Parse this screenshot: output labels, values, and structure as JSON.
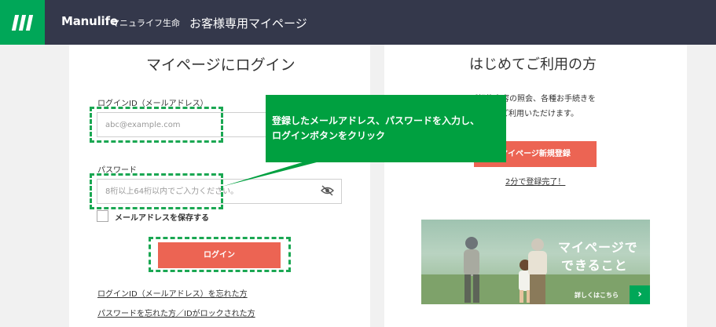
{
  "header": {
    "brand": "Manulife",
    "brand_sub": "マニュライフ生命",
    "title": "お客様専用マイページ"
  },
  "login": {
    "title": "マイページにログイン",
    "id_label": "ログインID（メールアドレス）",
    "id_placeholder": "abc@example.com",
    "password_label": "パスワード",
    "password_placeholder": "8桁以上64桁以内でご入力ください。",
    "save_label": "メールアドレスを保存する",
    "login_button": "ログイン",
    "forgot_id": "ログインID（メールアドレス）を忘れた方",
    "forgot_password": "パスワードを忘れた方／IDがロックされた方"
  },
  "first_time": {
    "title": "はじめてご利用の方",
    "desc_line1": "ご契約内容の照会、各種お手続きを",
    "desc_line2": "ご利用いただけます。",
    "register_button": "マイページ新規登録",
    "register_note": "2分で登録完了！"
  },
  "banner": {
    "title_line1": "マイページで",
    "title_line2": "できること",
    "link": "詳しくはこちら",
    "arrow": "›"
  },
  "callout": {
    "line1": "登録したメールアドレス、パスワードを入力し、",
    "line2": "ログインボタンをクリック"
  },
  "colors": {
    "header_bg": "#34384b",
    "brand_green": "#00a758",
    "button_coral": "#ec6453",
    "callout_green": "#00a040"
  },
  "icons": [
    "manulife-logo-icon",
    "eye-off-icon",
    "arrow-right-icon"
  ]
}
